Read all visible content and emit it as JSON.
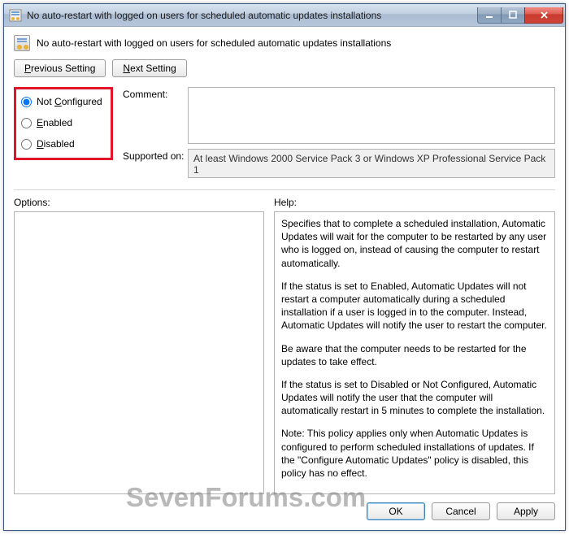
{
  "title": "No auto-restart with logged on users for scheduled automatic updates installations",
  "heading": "No auto-restart with logged on users for scheduled automatic updates installations",
  "nav": {
    "prev": "Previous Setting",
    "next": "Next Setting"
  },
  "radios": {
    "not_configured": "Not Configured",
    "enabled": "Enabled",
    "disabled": "Disabled",
    "selected": "not_configured"
  },
  "labels": {
    "comment": "Comment:",
    "supported": "Supported on:",
    "options": "Options:",
    "help": "Help:"
  },
  "comment_value": "",
  "supported_text": "At least Windows 2000 Service Pack 3 or Windows XP Professional Service Pack 1",
  "help": {
    "p1": "Specifies that to complete a scheduled installation, Automatic Updates will wait for the computer to be restarted by any user who is logged on, instead of causing the computer to restart automatically.",
    "p2": "If the status is set to Enabled, Automatic Updates will not restart a computer automatically during a scheduled installation if a user is logged in to the computer. Instead, Automatic Updates will notify the user to restart the computer.",
    "p3": "Be aware that the computer needs to be restarted for the updates to take effect.",
    "p4": "If the status is set to Disabled or Not Configured, Automatic Updates will notify the user that the computer will automatically restart in 5 minutes to complete the installation.",
    "p5": "Note: This policy applies only when Automatic Updates is configured to perform scheduled installations of updates. If the \"Configure Automatic Updates\" policy is disabled, this policy has no effect."
  },
  "footer": {
    "ok": "OK",
    "cancel": "Cancel",
    "apply": "Apply"
  },
  "watermark": "SevenForums.com"
}
